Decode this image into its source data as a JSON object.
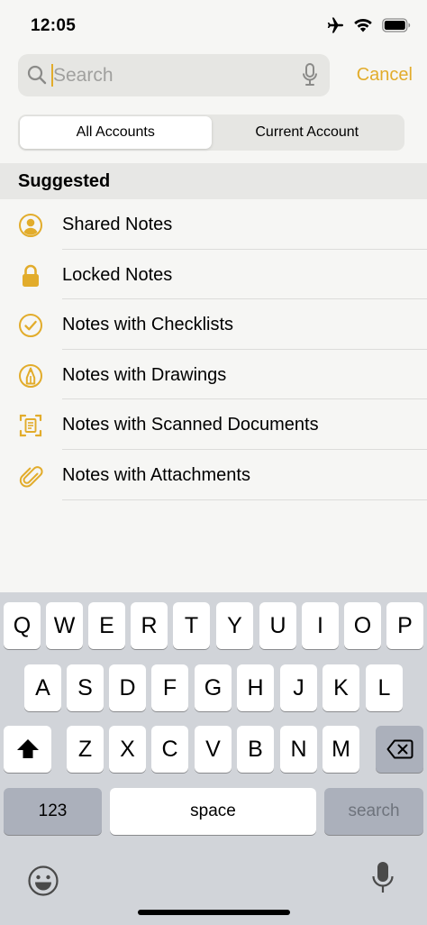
{
  "status_bar": {
    "time": "12:05",
    "icons": [
      "airplane-icon",
      "wifi-icon",
      "battery-icon"
    ]
  },
  "search": {
    "placeholder": "Search",
    "value": "",
    "cancel_label": "Cancel"
  },
  "scope": {
    "options": [
      "All Accounts",
      "Current Account"
    ],
    "selected": "All Accounts"
  },
  "suggested": {
    "header": "Suggested",
    "items": [
      {
        "label": "Shared Notes",
        "icon": "shared-person-icon"
      },
      {
        "label": "Locked Notes",
        "icon": "lock-icon"
      },
      {
        "label": "Notes with Checklists",
        "icon": "checklist-icon"
      },
      {
        "label": "Notes with Drawings",
        "icon": "drawing-icon"
      },
      {
        "label": "Notes with Scanned Documents",
        "icon": "scan-document-icon"
      },
      {
        "label": "Notes with Attachments",
        "icon": "paperclip-icon"
      }
    ]
  },
  "keyboard": {
    "row1": [
      "Q",
      "W",
      "E",
      "R",
      "T",
      "Y",
      "U",
      "I",
      "O",
      "P"
    ],
    "row2": [
      "A",
      "S",
      "D",
      "F",
      "G",
      "H",
      "J",
      "K",
      "L"
    ],
    "row3": [
      "Z",
      "X",
      "C",
      "V",
      "B",
      "N",
      "M"
    ],
    "numbers_label": "123",
    "space_label": "space",
    "search_label": "search"
  },
  "colors": {
    "accent": "#e2ac2b",
    "background": "#f6f6f4",
    "keyboard_bg": "#d1d4d9",
    "key_dark": "#abb0bb"
  }
}
